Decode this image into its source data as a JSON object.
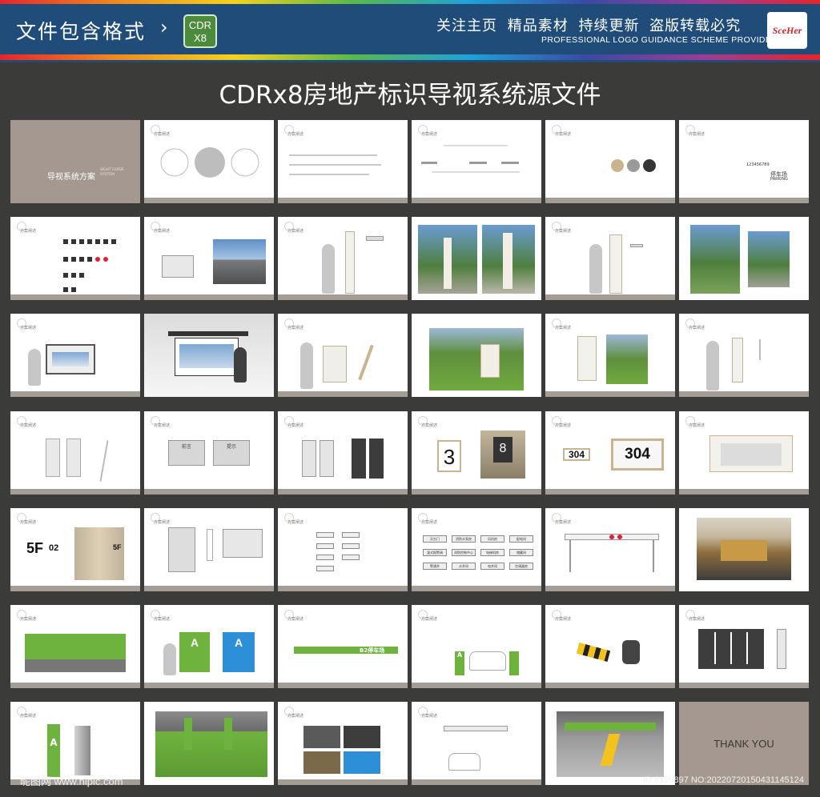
{
  "banner": {
    "left_title": "文件包含格式",
    "arrow": "›",
    "format_badge_line1": "CDR",
    "format_badge_line2": "X8",
    "right_slogans": "关注主页 精品素材 持续更新 盗版转载必究",
    "right_subtitle": "PROFESSIONAL LOGO GUIDANCE SCHEME PROVIDER",
    "logo_text": "SceHer"
  },
  "main_title": "CDRx8房地产标识导视系统源文件",
  "slides": {
    "cover_title": "导视系统方案",
    "cover_sub_line1": "SIGHT GUIDE",
    "cover_sub_line2": "SYSTEM",
    "section_label": "方案阐述",
    "parking_label": "停车场",
    "parking_en": "PARKING",
    "parking_number": "123456789",
    "room_numbers": [
      "3",
      "8",
      "304",
      "304"
    ],
    "floor_label": "5F",
    "floor_number": "02",
    "floor_label_short": "5F",
    "board_title_1": "前言",
    "board_title_2": "提示",
    "zone_letter": "A",
    "facility_labels": [
      "天台门",
      "消防水泵房",
      "风机房",
      "配电间",
      "湿式报警阀",
      "消防控制中心",
      "电梯机房",
      "储藏间",
      "警通井",
      "水井间",
      "电井间",
      "空调器房"
    ],
    "arrow_sign_text": "B2停车场",
    "thank_you": "THANK YOU"
  },
  "footer": {
    "watermark": "昵图网 www.nipic.com",
    "image_id": "ID:8129897 NO:20220720150431145124"
  },
  "colors": {
    "banner_bg": "#1f4c79",
    "page_bg": "#3b3b39",
    "accent_taupe": "#a49890",
    "accent_green": "#6fb33f"
  }
}
